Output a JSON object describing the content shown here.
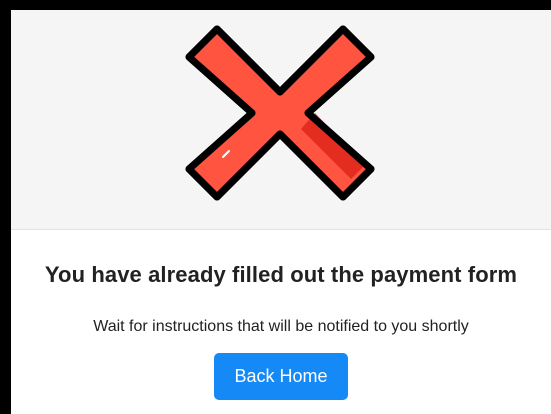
{
  "icon": {
    "name": "x-mark-icon",
    "fill_color": "#ff5440",
    "shade_color": "#e0261c",
    "outline_color": "#000000"
  },
  "message": {
    "heading": "You have already filled out the payment form",
    "subtext": "Wait for instructions that will be notified to you shortly"
  },
  "actions": {
    "back_home_label": "Back Home",
    "button_color": "#1589f5"
  }
}
